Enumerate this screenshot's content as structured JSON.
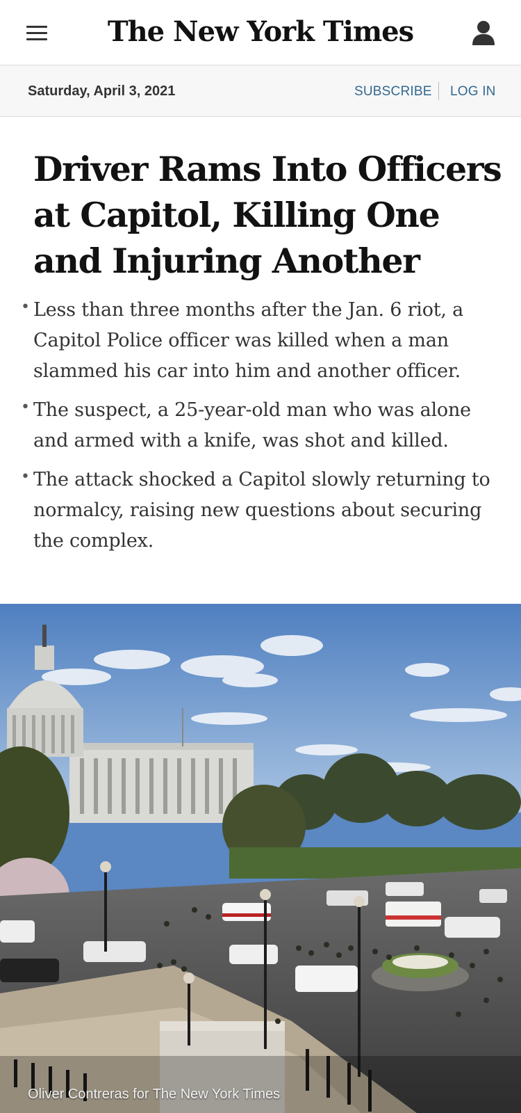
{
  "header": {
    "logo_text": "The New York Times",
    "menu_icon": "hamburger-menu-icon",
    "account_icon": "user-account-icon"
  },
  "datebar": {
    "date": "Saturday, April 3, 2021",
    "subscribe_label": "SUBSCRIBE",
    "login_label": "LOG IN"
  },
  "article": {
    "headline_lines": [
      "Driver Rams Into Officers",
      "at Capitol, Killing One",
      "and Injuring Another"
    ],
    "summary": [
      "Less than three months after the Jan. 6 riot, a Capitol Police officer was killed when a man slammed his car into him and another officer.",
      "The suspect, a 25-year-old man who was alone and armed with a knife, was shot and killed.",
      "The attack shocked a Capitol slowly returning to normalcy, raising new questions about securing the complex."
    ],
    "photo_credit": "Oliver Contreras for The New York Times"
  },
  "colors": {
    "link": "#326891",
    "text": "#121212",
    "datebar_bg": "#f7f7f7",
    "sky": "#5b87c3"
  }
}
